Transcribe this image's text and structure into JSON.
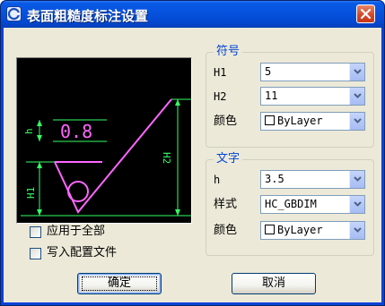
{
  "window": {
    "title": "表面粗糙度标注设置",
    "app_icon": "gear-c-icon",
    "close_icon": "close-icon"
  },
  "preview": {
    "value_text": "0.8",
    "h_label": "h",
    "h1_label": "H1",
    "h2_label": "H2"
  },
  "symbol_group": {
    "title": "符号",
    "rows": [
      {
        "label": "H1",
        "value": "5"
      },
      {
        "label": "H2",
        "value": "11"
      },
      {
        "label": "颜色",
        "value": "ByLayer"
      }
    ]
  },
  "text_group": {
    "title": "文字",
    "rows": [
      {
        "label": "h",
        "value": "3.5"
      },
      {
        "label": "样式",
        "value": "HC_GBDIM"
      },
      {
        "label": "颜色",
        "value": "ByLayer"
      }
    ]
  },
  "options": {
    "apply_all_label": "应用于全部",
    "write_config_label": "写入配置文件",
    "apply_all_checked": false,
    "write_config_checked": false
  },
  "buttons": {
    "ok_label": "确定",
    "cancel_label": "取消"
  },
  "colors": {
    "titlebar": "#0652dd",
    "dialog_bg": "#ece9d8",
    "legend_text": "#0046d5",
    "preview_bg": "#000000",
    "preview_green": "#33ff66",
    "preview_magenta": "#ff66ff"
  }
}
